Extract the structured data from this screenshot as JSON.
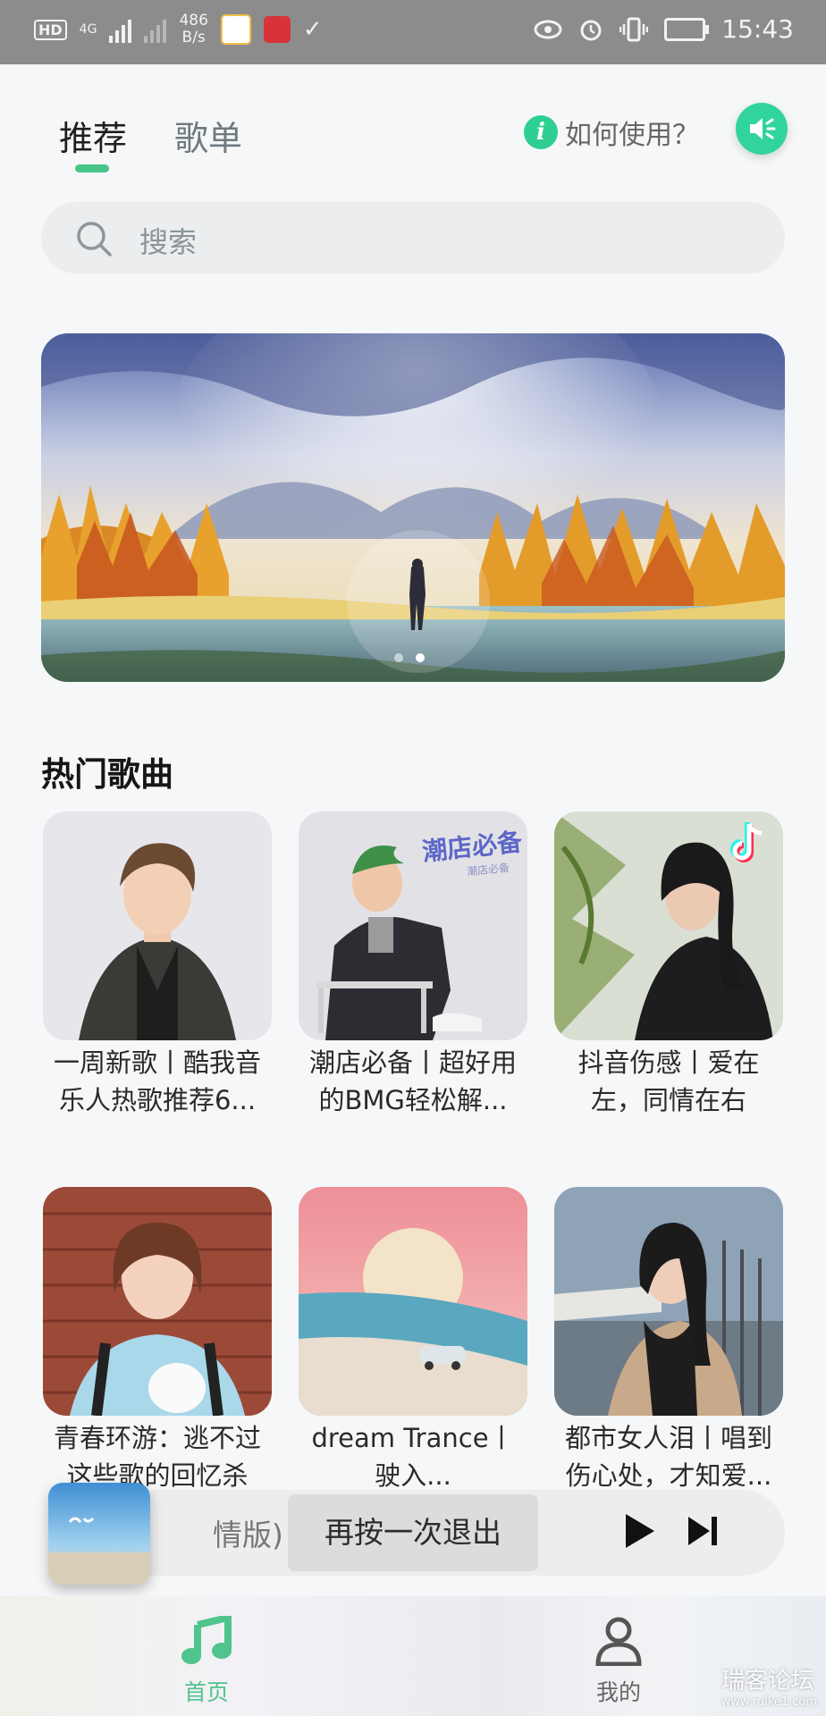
{
  "status_bar": {
    "hd_label": "HD",
    "network": "4G",
    "speed_value": "486",
    "speed_unit": "B/s",
    "time": "15:43",
    "icons": [
      "eye-icon",
      "alarm-icon",
      "vibrate-icon",
      "battery-charging-icon"
    ]
  },
  "header": {
    "tabs": [
      {
        "label": "推荐",
        "active": true
      },
      {
        "label": "歌单",
        "active": false
      }
    ],
    "help_icon_text": "i",
    "help_label": "如何使用？",
    "accent_color": "#31d49a"
  },
  "search": {
    "placeholder": "搜索"
  },
  "banner": {
    "slides": 2,
    "active_slide": 2
  },
  "hot_songs": {
    "title": "热门歌曲",
    "items": [
      {
        "caption": "一周新歌丨酷我音乐人热歌推荐6..."
      },
      {
        "caption": "潮店必备丨超好用的BMG轻松解...",
        "cover_text": "潮店必备",
        "cover_subtext": "潮店必备"
      },
      {
        "caption": "抖音伤感丨爱在左，同情在右"
      },
      {
        "caption": "青春环游：逃不过这些歌的回忆杀"
      },
      {
        "caption": "dream Trance丨驶入..."
      },
      {
        "caption": "都市女人泪丨唱到伤心处，才知爱..."
      }
    ]
  },
  "player": {
    "scrolling_title": "情版)",
    "toast": "再按一次退出",
    "controls": [
      "play-icon",
      "next-track-icon"
    ]
  },
  "bottom_nav": {
    "items": [
      {
        "label": "首页",
        "active": true,
        "icon": "music-note-icon"
      },
      {
        "label": "我的",
        "active": false,
        "icon": "user-icon"
      }
    ]
  },
  "watermark": {
    "text": "瑞客论坛",
    "subtext": "www.ruike1.com"
  }
}
